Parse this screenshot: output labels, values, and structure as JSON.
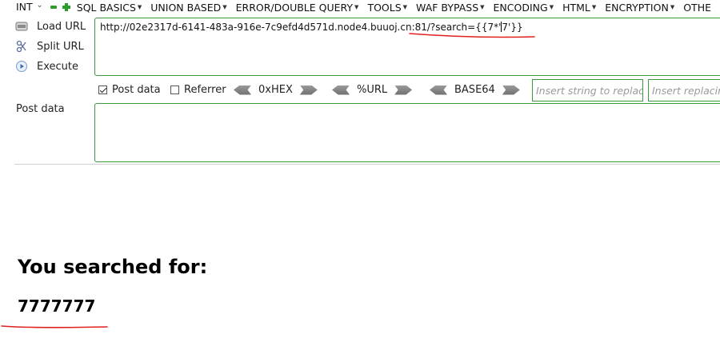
{
  "toolbar": {
    "select_value": "INT",
    "menus": [
      "SQL BASICS",
      "UNION BASED",
      "ERROR/DOUBLE QUERY",
      "TOOLS",
      "WAF BYPASS",
      "ENCODING",
      "HTML",
      "ENCRYPTION",
      "OTHE"
    ]
  },
  "tools": {
    "load_url": "Load URL",
    "split_url": "Split URL",
    "execute": "Execute"
  },
  "url": {
    "before_caret": "http://02e2317d-6141-483a-916e-7c9efd4d571d.node4.buuoj.cn:81/?search={{7*'",
    "after_caret": "7'}}"
  },
  "options": {
    "post_data_label": "Post data",
    "post_data_checked": true,
    "referrer_label": "Referrer",
    "referrer_checked": false,
    "hex_label": "0xHEX",
    "url_label": "%URL",
    "base64_label": "BASE64",
    "replace_placeholder": "Insert string to replace",
    "replacing_placeholder": "Insert replacing string"
  },
  "post_data": {
    "label": "Post data",
    "value": ""
  },
  "page": {
    "heading": "You searched for:",
    "result": "7777777"
  },
  "colors": {
    "accent_green": "#3c9a3c",
    "annotation_red": "#e0201e"
  }
}
